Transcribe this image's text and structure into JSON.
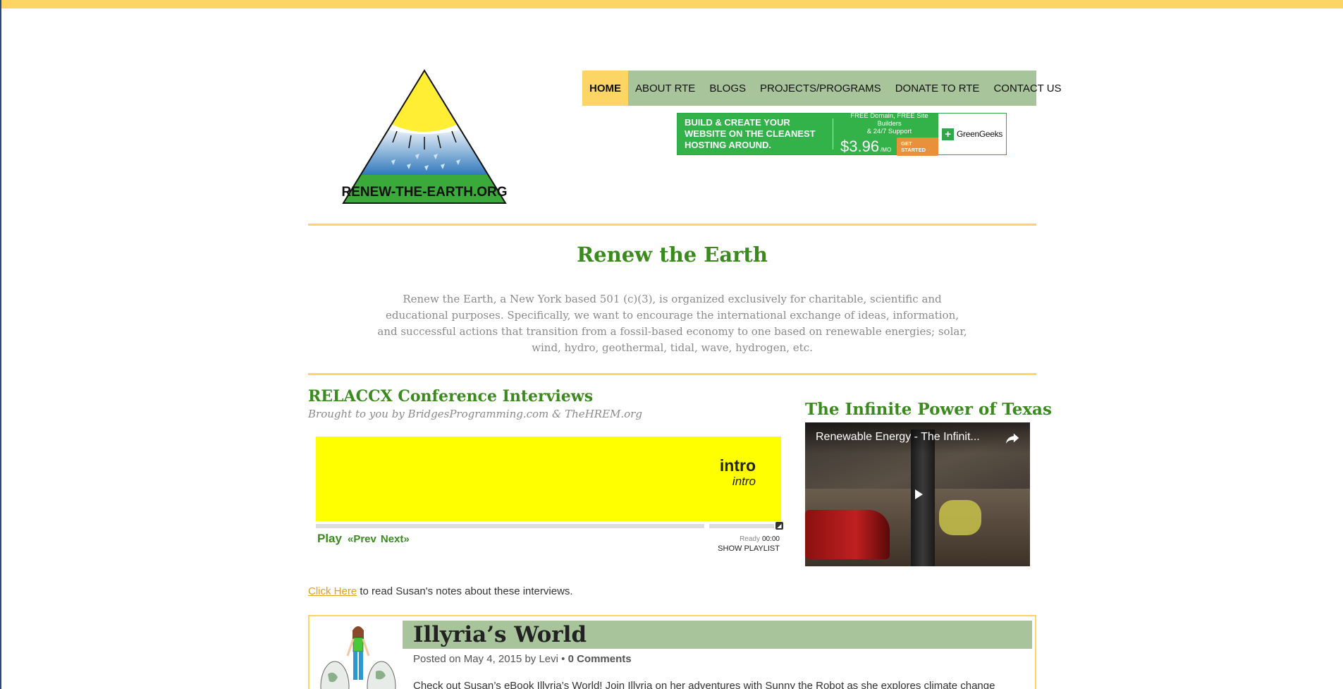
{
  "site": {
    "logo_text": "RENEW-THE-EARTH.ORG",
    "title": "Renew the Earth",
    "mission": "Renew the Earth, a New York based 501 (c)(3), is organized exclusively for charitable, scientific and educational purposes. Specifically, we want to encourage the international exchange of ideas, information, and successful actions that transition from a fossil-based economy to one based on renewable energies; solar, wind, hydro, geothermal, tidal, wave, hydrogen, etc."
  },
  "nav": {
    "items": [
      {
        "label": "HOME",
        "active": true
      },
      {
        "label": "ABOUT RTE",
        "active": false
      },
      {
        "label": "BLOGS",
        "active": false
      },
      {
        "label": "PROJECTS/PROGRAMS",
        "active": false
      },
      {
        "label": "DONATE TO RTE",
        "active": false
      },
      {
        "label": "CONTACT US",
        "active": false
      }
    ]
  },
  "ad": {
    "headline": "BUILD & CREATE YOUR WEBSITE ON THE CLEANEST HOSTING AROUND.",
    "offer_line1": "FREE Domain, FREE Site Builders",
    "offer_line2": "& 24/7 Support",
    "price": "$3.96",
    "price_unit": "/MO",
    "cta": "GET STARTED",
    "brand": "GreenGeeks"
  },
  "relaccx": {
    "title": "RELACCX Conference Interviews",
    "subtitle": "Brought to you by BridgesProgramming.com & TheHREM.org"
  },
  "player": {
    "track_title": "intro",
    "track_subtitle": "intro",
    "play_label": "Play",
    "prev_label": "«Prev",
    "next_label": "Next»",
    "status": "Ready",
    "time": "00:00",
    "playlist_label": "SHOW PLAYLIST"
  },
  "notes": {
    "link_text": "Click Here",
    "rest_text": " to read Susan's notes about these interviews."
  },
  "texas": {
    "title": "The Infinite Power of Texas",
    "video_title": "Renewable Energy - The Infinit..."
  },
  "post": {
    "title": "Illyria’s World",
    "meta_prefix": "Posted on May 4, 2015 by Levi • ",
    "comments": "0 Comments",
    "excerpt": "Check out Susan’s eBook Illyria’s World! Join Illyria on her adventures with Sunny the Robot as she explores climate change"
  },
  "colors": {
    "accent_yellow": "#fcd565",
    "nav_green": "#a8c49a",
    "title_green": "#3a8a1e",
    "player_yellow": "#ffff00"
  }
}
